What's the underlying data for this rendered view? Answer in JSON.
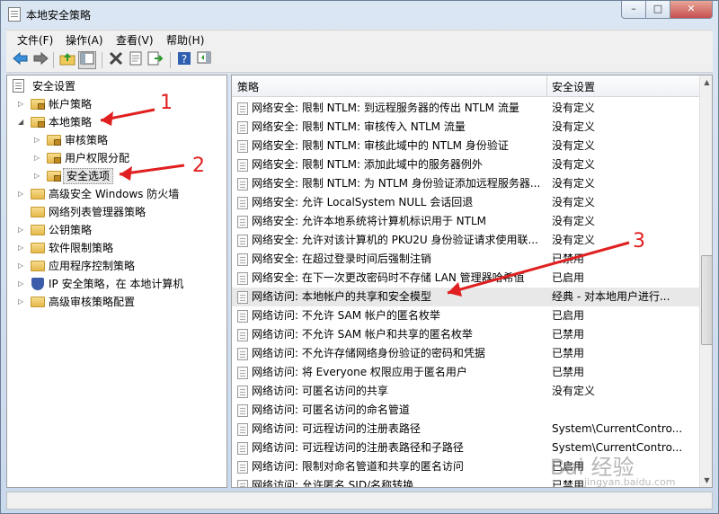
{
  "window": {
    "title": "本地安全策略",
    "min_glyph": "–",
    "max_glyph": "□",
    "close_glyph": "✕"
  },
  "menu": [
    "文件(F)",
    "操作(A)",
    "查看(V)",
    "帮助(H)"
  ],
  "toolbar": {
    "icons": [
      "back-arrow-icon",
      "forward-arrow-icon",
      "up-folder-icon",
      "show-hide-tree-icon",
      "delete-icon",
      "properties-icon",
      "export-list-icon",
      "help-icon",
      "show-hide-action-pane-icon"
    ]
  },
  "tree": {
    "root": "安全设置",
    "items": [
      {
        "label": "帐户策略",
        "depth": 1,
        "expander": "▷"
      },
      {
        "label": "本地策略",
        "depth": 1,
        "expander": "◢"
      },
      {
        "label": "审核策略",
        "depth": 2,
        "expander": "▷"
      },
      {
        "label": "用户权限分配",
        "depth": 2,
        "expander": "▷"
      },
      {
        "label": "安全选项",
        "depth": 2,
        "expander": "▷",
        "selected": true
      },
      {
        "label": "高级安全 Windows 防火墙",
        "depth": 1,
        "expander": "▷"
      },
      {
        "label": "网络列表管理器策略",
        "depth": 1,
        "expander": ""
      },
      {
        "label": "公钥策略",
        "depth": 1,
        "expander": "▷"
      },
      {
        "label": "软件限制策略",
        "depth": 1,
        "expander": "▷"
      },
      {
        "label": "应用程序控制策略",
        "depth": 1,
        "expander": "▷"
      },
      {
        "label": "IP 安全策略，在 本地计算机",
        "depth": 1,
        "expander": "▷",
        "icon": "shield"
      },
      {
        "label": "高级审核策略配置",
        "depth": 1,
        "expander": "▷"
      }
    ]
  },
  "list": {
    "columns": [
      "策略",
      "安全设置"
    ],
    "rows": [
      {
        "policy": "网络安全: 限制 NTLM: 到远程服务器的传出 NTLM 流量",
        "setting": "没有定义"
      },
      {
        "policy": "网络安全: 限制 NTLM: 审核传入 NTLM 流量",
        "setting": "没有定义"
      },
      {
        "policy": "网络安全: 限制 NTLM: 审核此域中的 NTLM 身份验证",
        "setting": "没有定义"
      },
      {
        "policy": "网络安全: 限制 NTLM: 添加此域中的服务器例外",
        "setting": "没有定义"
      },
      {
        "policy": "网络安全: 限制 NTLM: 为 NTLM 身份验证添加远程服务器...",
        "setting": "没有定义"
      },
      {
        "policy": "网络安全: 允许 LocalSystem NULL 会话回退",
        "setting": "没有定义"
      },
      {
        "policy": "网络安全: 允许本地系统将计算机标识用于 NTLM",
        "setting": "没有定义"
      },
      {
        "policy": "网络安全: 允许对该计算机的 PKU2U 身份验证请求使用联...",
        "setting": "没有定义"
      },
      {
        "policy": "网络安全: 在超过登录时间后强制注销",
        "setting": "已禁用"
      },
      {
        "policy": "网络安全: 在下一次更改密码时不存储 LAN 管理器哈希值",
        "setting": "已启用"
      },
      {
        "policy": "网络访问: 本地帐户的共享和安全模型",
        "setting": "经典 - 对本地用户进行...",
        "selected": true
      },
      {
        "policy": "网络访问: 不允许 SAM 帐户的匿名枚举",
        "setting": "已启用"
      },
      {
        "policy": "网络访问: 不允许 SAM 帐户和共享的匿名枚举",
        "setting": "已禁用"
      },
      {
        "policy": "网络访问: 不允许存储网络身份验证的密码和凭据",
        "setting": "已禁用"
      },
      {
        "policy": "网络访问: 将 Everyone 权限应用于匿名用户",
        "setting": "已禁用"
      },
      {
        "policy": "网络访问: 可匿名访问的共享",
        "setting": "没有定义"
      },
      {
        "policy": "网络访问: 可匿名访问的命名管道",
        "setting": ""
      },
      {
        "policy": "网络访问: 可远程访问的注册表路径",
        "setting": "System\\CurrentContro..."
      },
      {
        "policy": "网络访问: 可远程访问的注册表路径和子路径",
        "setting": "System\\CurrentContro..."
      },
      {
        "policy": "网络访问: 限制对命名管道和共享的匿名访问",
        "setting": "已启用"
      },
      {
        "policy": "网络访问: 允许匿名 SID/名称转换",
        "setting": "已禁用"
      }
    ]
  },
  "annotations": [
    "1",
    "2",
    "3"
  ],
  "watermark": {
    "text": "Bai 经验",
    "sub": "jingyan.baidu.com"
  },
  "colors": {
    "annotation": "#e02020",
    "selection": "#e8e8e8"
  }
}
